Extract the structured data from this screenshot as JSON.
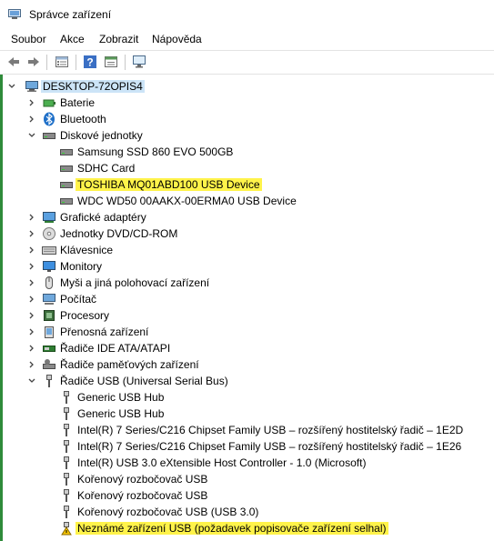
{
  "window": {
    "title": "Správce zařízení"
  },
  "menu": {
    "items": [
      "Soubor",
      "Akce",
      "Zobrazit",
      "Nápověda"
    ]
  },
  "toolbar": {
    "buttons": [
      "back-arrow-icon",
      "forward-arrow-icon",
      "properties-icon",
      "help-icon",
      "update-driver-icon",
      "monitor-scan-icon"
    ]
  },
  "tree": {
    "root": "DESKTOP-72OPIS4",
    "batteries": "Baterie",
    "bluetooth": "Bluetooth",
    "disks": "Diskové jednotky",
    "disk_items": [
      "Samsung SSD 860 EVO 500GB",
      "SDHC Card",
      "TOSHIBA MQ01ABD100 USB Device",
      "WDC WD50 00AAKX-00ERMA0 USB Device"
    ],
    "display": "Grafické adaptéry",
    "dvd": "Jednotky DVD/CD-ROM",
    "keyboards": "Klávesnice",
    "monitors": "Monitory",
    "mice": "Myši a jiná polohovací zařízení",
    "computer": "Počítač",
    "processors": "Procesory",
    "portable": "Přenosná zařízení",
    "ide": "Řadiče IDE ATA/ATAPI",
    "storage": "Řadiče paměťových zařízení",
    "usb": "Řadiče USB (Universal Serial Bus)",
    "usb_items": [
      "Generic USB Hub",
      "Generic USB Hub",
      "Intel(R) 7 Series/C216 Chipset Family USB – rozšířený hostitelský řadič – 1E2D",
      "Intel(R) 7 Series/C216 Chipset Family USB – rozšířený hostitelský řadič – 1E26",
      "Intel(R) USB 3.0 eXtensible Host Controller - 1.0 (Microsoft)",
      "Kořenový rozbočovač USB",
      "Kořenový rozbočovač USB",
      "Kořenový rozbočovač USB (USB 3.0)",
      "Neznámé zařízení USB (požadavek popisovače zařízení selhal)"
    ]
  },
  "highlight_color": "#fff34a",
  "warning_color": "#f5c400"
}
